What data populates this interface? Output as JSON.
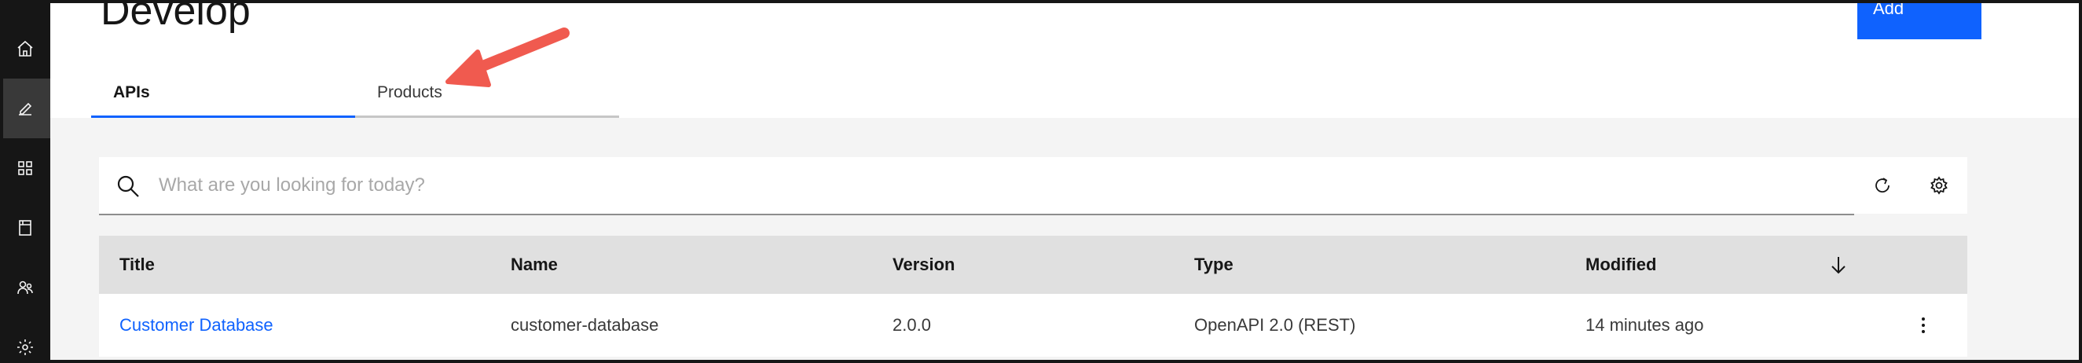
{
  "page": {
    "title": "Develop",
    "add_label": "Add"
  },
  "tabs": [
    {
      "label": "APIs",
      "active": true
    },
    {
      "label": "Products",
      "active": false
    }
  ],
  "sidebar": {
    "items": [
      {
        "icon": "home-icon",
        "active": false
      },
      {
        "icon": "edit-icon",
        "active": true
      },
      {
        "icon": "grid-icon",
        "active": false
      },
      {
        "icon": "catalog-icon",
        "active": false
      },
      {
        "icon": "users-icon",
        "active": false
      },
      {
        "icon": "settings-icon",
        "active": false
      }
    ]
  },
  "search": {
    "placeholder": "What are you looking for today?",
    "value": ""
  },
  "toolbar": {
    "refresh_icon": "refresh-icon",
    "settings_icon": "gear-icon"
  },
  "table": {
    "headers": {
      "title": "Title",
      "name": "Name",
      "version": "Version",
      "type": "Type",
      "modified": "Modified"
    },
    "rows": [
      {
        "title": "Customer Database",
        "name": "customer-database",
        "version": "2.0.0",
        "type": "OpenAPI 2.0 (REST)",
        "modified": "14 minutes ago"
      }
    ]
  },
  "colors": {
    "accent": "#0f62fe",
    "sidebar": "#161616",
    "callout": "#f05a4f"
  }
}
